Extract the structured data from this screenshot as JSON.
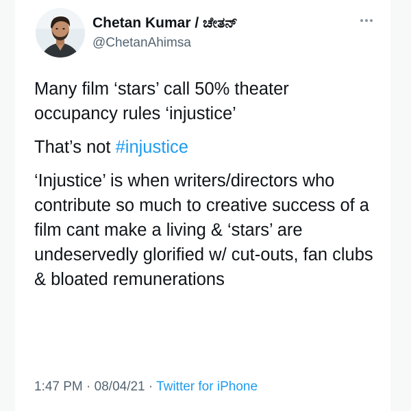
{
  "author": {
    "display_name": "Chetan Kumar / ಚೇತನ್",
    "handle": "@ChetanAhimsa"
  },
  "tweet": {
    "paragraph1": "Many film ‘stars’ call 50% theater occupancy rules ‘injustice’",
    "paragraph2_prefix": "That’s not ",
    "paragraph2_hashtag": "#injustice",
    "paragraph3": "‘Injustice’ is when writers/directors who contribute so much to creative success of a film cant make a living & ‘stars’ are undeservedly glorified w/ cut-outs, fan clubs & bloated remunerations"
  },
  "meta": {
    "time": "1:47 PM",
    "separator1": " · ",
    "date": "08/04/21",
    "separator2": " · ",
    "source": "Twitter for iPhone"
  },
  "colors": {
    "link": "#1d9bf0",
    "secondary_text": "#536471",
    "primary_text": "#0f1419"
  },
  "icons": {
    "more": "more-options-icon"
  }
}
